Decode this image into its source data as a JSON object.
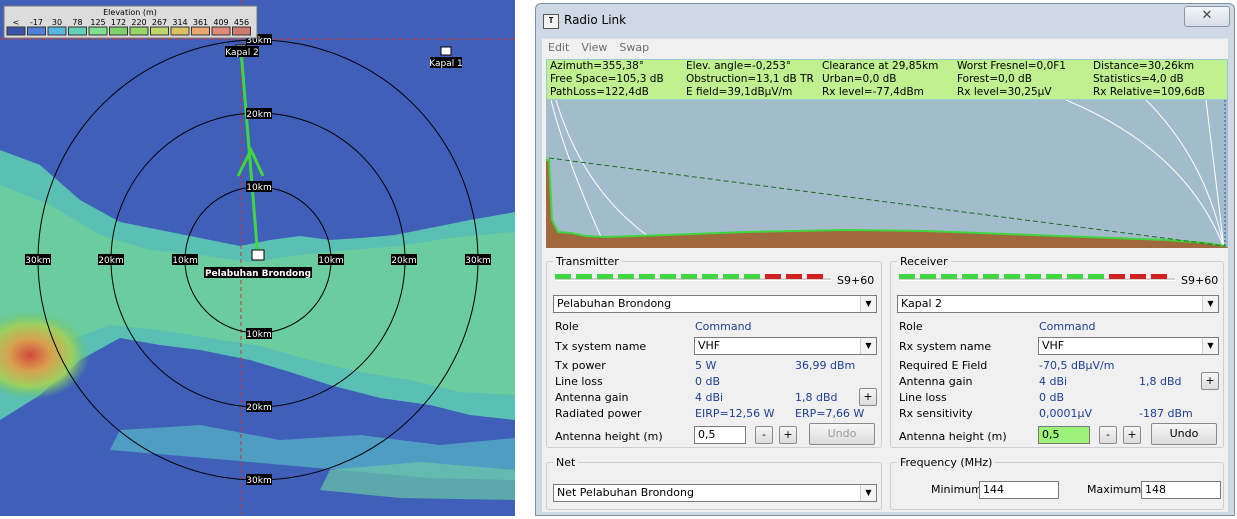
{
  "map": {
    "legend_title": "Elevation (m)",
    "legend_values": [
      "<",
      "-17",
      "30",
      "78",
      "125",
      "172",
      "220",
      "267",
      "314",
      "361",
      "409",
      "456"
    ],
    "legend_colors": [
      "#3a55a8",
      "#4f7fd8",
      "#58b8e0",
      "#64d0b8",
      "#80e090",
      "#7ed36a",
      "#98d66a",
      "#c0d66a",
      "#dcc064",
      "#e8a870",
      "#e08a7a",
      "#d07a70"
    ],
    "ring_labels": {
      "top_30": "30km",
      "top_20": "20km",
      "top_10": "10km",
      "bottom_10": "10km",
      "bottom_20": "20km",
      "bottom_30": "30km",
      "left_30": "30km",
      "left_20": "20km",
      "left_10": "10km",
      "right_10": "10km",
      "right_20": "20km",
      "right_30": "30km"
    },
    "station_tx": "Pelabuhan Brondong",
    "station_rx": "Kapal 2",
    "station_other": "Kapal 1"
  },
  "window": {
    "title": "Radio Link",
    "close_label": "✕",
    "menu": [
      "Edit",
      "View",
      "Swap"
    ]
  },
  "status": {
    "row1": [
      "Azimuth=355,38°",
      "Elev. angle=-0,253°",
      "Clearance at 29,85km",
      "Worst Fresnel=0,0F1",
      "Distance=30,26km"
    ],
    "row2": [
      "Free Space=105,3 dB",
      "Obstruction=13,1 dB TR",
      "Urban=0,0 dB",
      "Forest=0,0 dB",
      "Statistics=4,0 dB"
    ],
    "row3": [
      "PathLoss=122,4dB",
      "E field=39,1dBµV/m",
      "Rx level=-77,4dBm",
      "Rx level=30,25µV",
      "Rx Relative=109,6dB"
    ]
  },
  "transmitter": {
    "group_title": "Transmitter",
    "meter_label": "S9+60",
    "station": "Pelabuhan Brondong",
    "role_label": "Role",
    "role_value": "Command",
    "system_label": "Tx system name",
    "system_value": "VHF",
    "power_label": "Tx power",
    "power_w": "5 W",
    "power_dbm": "36,99 dBm",
    "loss_label": "Line loss",
    "loss_value": "0 dB",
    "gain_label": "Antenna gain",
    "gain_dbi": "4 dBi",
    "gain_dbd": "1,8 dBd",
    "radiated_label": "Radiated power",
    "eirp": "EIRP=12,56 W",
    "erp": "ERP=7,66 W",
    "height_label": "Antenna height (m)",
    "height_value": "0,5",
    "minus": "-",
    "plus": "+",
    "undo": "Undo"
  },
  "receiver": {
    "group_title": "Receiver",
    "meter_label": "S9+60",
    "station": "Kapal 2",
    "role_label": "Role",
    "role_value": "Command",
    "system_label": "Rx system name",
    "system_value": "VHF",
    "field_label": "Required E Field",
    "field_value": "-70,5 dBµV/m",
    "gain_label": "Antenna gain",
    "gain_dbi": "4 dBi",
    "gain_dbd": "1,8 dBd",
    "loss_label": "Line loss",
    "loss_value": "0 dB",
    "sens_label": "Rx sensitivity",
    "sens_uv": "0,0001µV",
    "sens_dbm": "-187 dBm",
    "height_label": "Antenna height (m)",
    "height_value": "0,5",
    "minus": "-",
    "plus": "+",
    "undo": "Undo"
  },
  "net": {
    "group_title": "Net",
    "value": "Net Pelabuhan Brondong"
  },
  "frequency": {
    "group_title": "Frequency (MHz)",
    "min_label": "Minimum",
    "min_value": "144",
    "max_label": "Maximum",
    "max_value": "148"
  },
  "meter_levels": {
    "tx_active_segments": 10,
    "rx_active_segments": 10
  },
  "colors": {
    "status_bg": "#c0f08f",
    "sky": "#a3bccc",
    "terrain": "#a0683c",
    "link_line": "#3fd63f"
  }
}
